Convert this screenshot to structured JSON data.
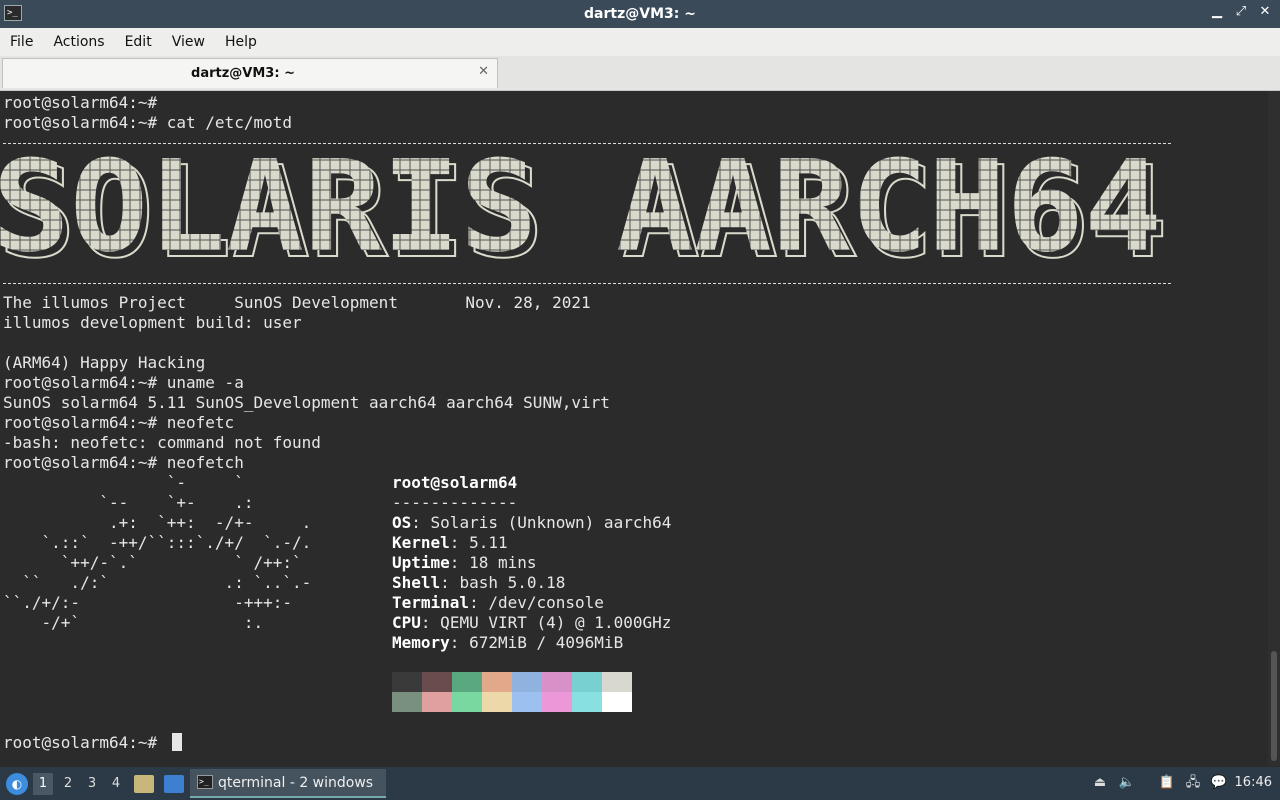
{
  "window": {
    "title": "dartz@VM3: ~",
    "app_icon_glyph": ">_",
    "controls": {
      "minimize": "▁",
      "maximize": "⤢",
      "close": "✕"
    }
  },
  "menu": [
    "File",
    "Actions",
    "Edit",
    "View",
    "Help"
  ],
  "tab": {
    "label": "dartz@VM3: ~",
    "close": "✕"
  },
  "terminal": {
    "lines_top": [
      "root@solarm64:~#",
      "root@solarm64:~# cat /etc/motd"
    ],
    "banner_text": "SOLARIS AARCH64",
    "motd_lines": [
      "The illumos Project     SunOS Development       Nov. 28, 2021",
      "illumos development build: user",
      "",
      "(ARM64) Happy Hacking",
      "root@solarm64:~# uname -a",
      "SunOS solarm64 5.11 SunOS_Development aarch64 aarch64 SUNW,virt",
      "root@solarm64:~# neofetc",
      "-bash: neofetc: command not found",
      "root@solarm64:~# neofetch"
    ],
    "ascii_logo": [
      "                 `-     `",
      "          `--    `+-    .:",
      "           .+:  `++:  -/+-     .",
      "    `.::`  -++/``:::`./+/  `.-/.",
      "      `++/-`.`          ` /++:`",
      "  ``   ./:`            .: `..`.-",
      "``./+/:-                -+++:-",
      "    -/+`                 :."
    ],
    "neofetch": {
      "user_host": "root@solarm64",
      "separator": "-------------",
      "fields": [
        {
          "key": "OS",
          "value": " Solaris (Unknown) aarch64"
        },
        {
          "key": "Kernel",
          "value": " 5.11"
        },
        {
          "key": "Uptime",
          "value": " 18 mins"
        },
        {
          "key": "Shell",
          "value": " bash 5.0.18"
        },
        {
          "key": "Terminal",
          "value": " /dev/console"
        },
        {
          "key": "CPU",
          "value": " QEMU VIRT (4) @ 1.000GHz"
        },
        {
          "key": "Memory",
          "value": " 672MiB / 4096MiB"
        }
      ],
      "palette_top": [
        "#3a3a3a",
        "#6a4b4e",
        "#5aa880",
        "#e2a88a",
        "#8fb2df",
        "#d890c8",
        "#78d0d0",
        "#d8d8d0"
      ],
      "palette_bottom": [
        "#7a907e",
        "#e0a0a0",
        "#78d8a0",
        "#ecd8a8",
        "#9cc0f0",
        "#ec98d8",
        "#88e0e0",
        "#ffffff"
      ]
    },
    "prompt": "root@solarm64:~#"
  },
  "taskbar": {
    "workspaces": [
      "1",
      "2",
      "3",
      "4"
    ],
    "task_label": "qterminal - 2 windows",
    "clock": "16:46"
  }
}
